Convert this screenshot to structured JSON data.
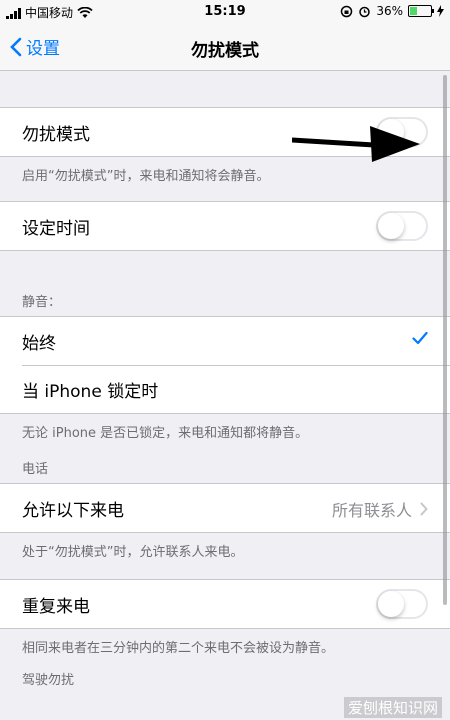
{
  "status_bar": {
    "carrier": "中国移动",
    "time": "15:19",
    "battery_percent": "36%",
    "battery_level": 0.36
  },
  "nav": {
    "back_label": "设置",
    "title": "勿扰模式"
  },
  "sections": {
    "dnd": {
      "label": "勿扰模式",
      "toggle_on": false,
      "note": "启用“勿扰模式”时，来电和通知将会静音。"
    },
    "schedule": {
      "label": "设定时间",
      "toggle_on": false
    },
    "silence": {
      "header": "静音：",
      "options": [
        "始终",
        "当 iPhone 锁定时"
      ],
      "selected": "始终",
      "note": "无论 iPhone 是否已锁定，来电和通知都将静音。"
    },
    "phone": {
      "header": "电话",
      "allow_calls_label": "允许以下来电",
      "allow_calls_value": "所有联系人",
      "note": "处于“勿扰模式”时，允许联系人来电。"
    },
    "repeated": {
      "label": "重复来电",
      "toggle_on": false,
      "note": "相同来电者在三分钟内的第二个来电不会被设为静音。"
    },
    "driving": {
      "header": "驾驶勿扰"
    }
  },
  "watermark": "爱刨根知识网",
  "colors": {
    "accent": "#007aff",
    "background": "#efeff4",
    "separator": "#c8c7cc"
  }
}
